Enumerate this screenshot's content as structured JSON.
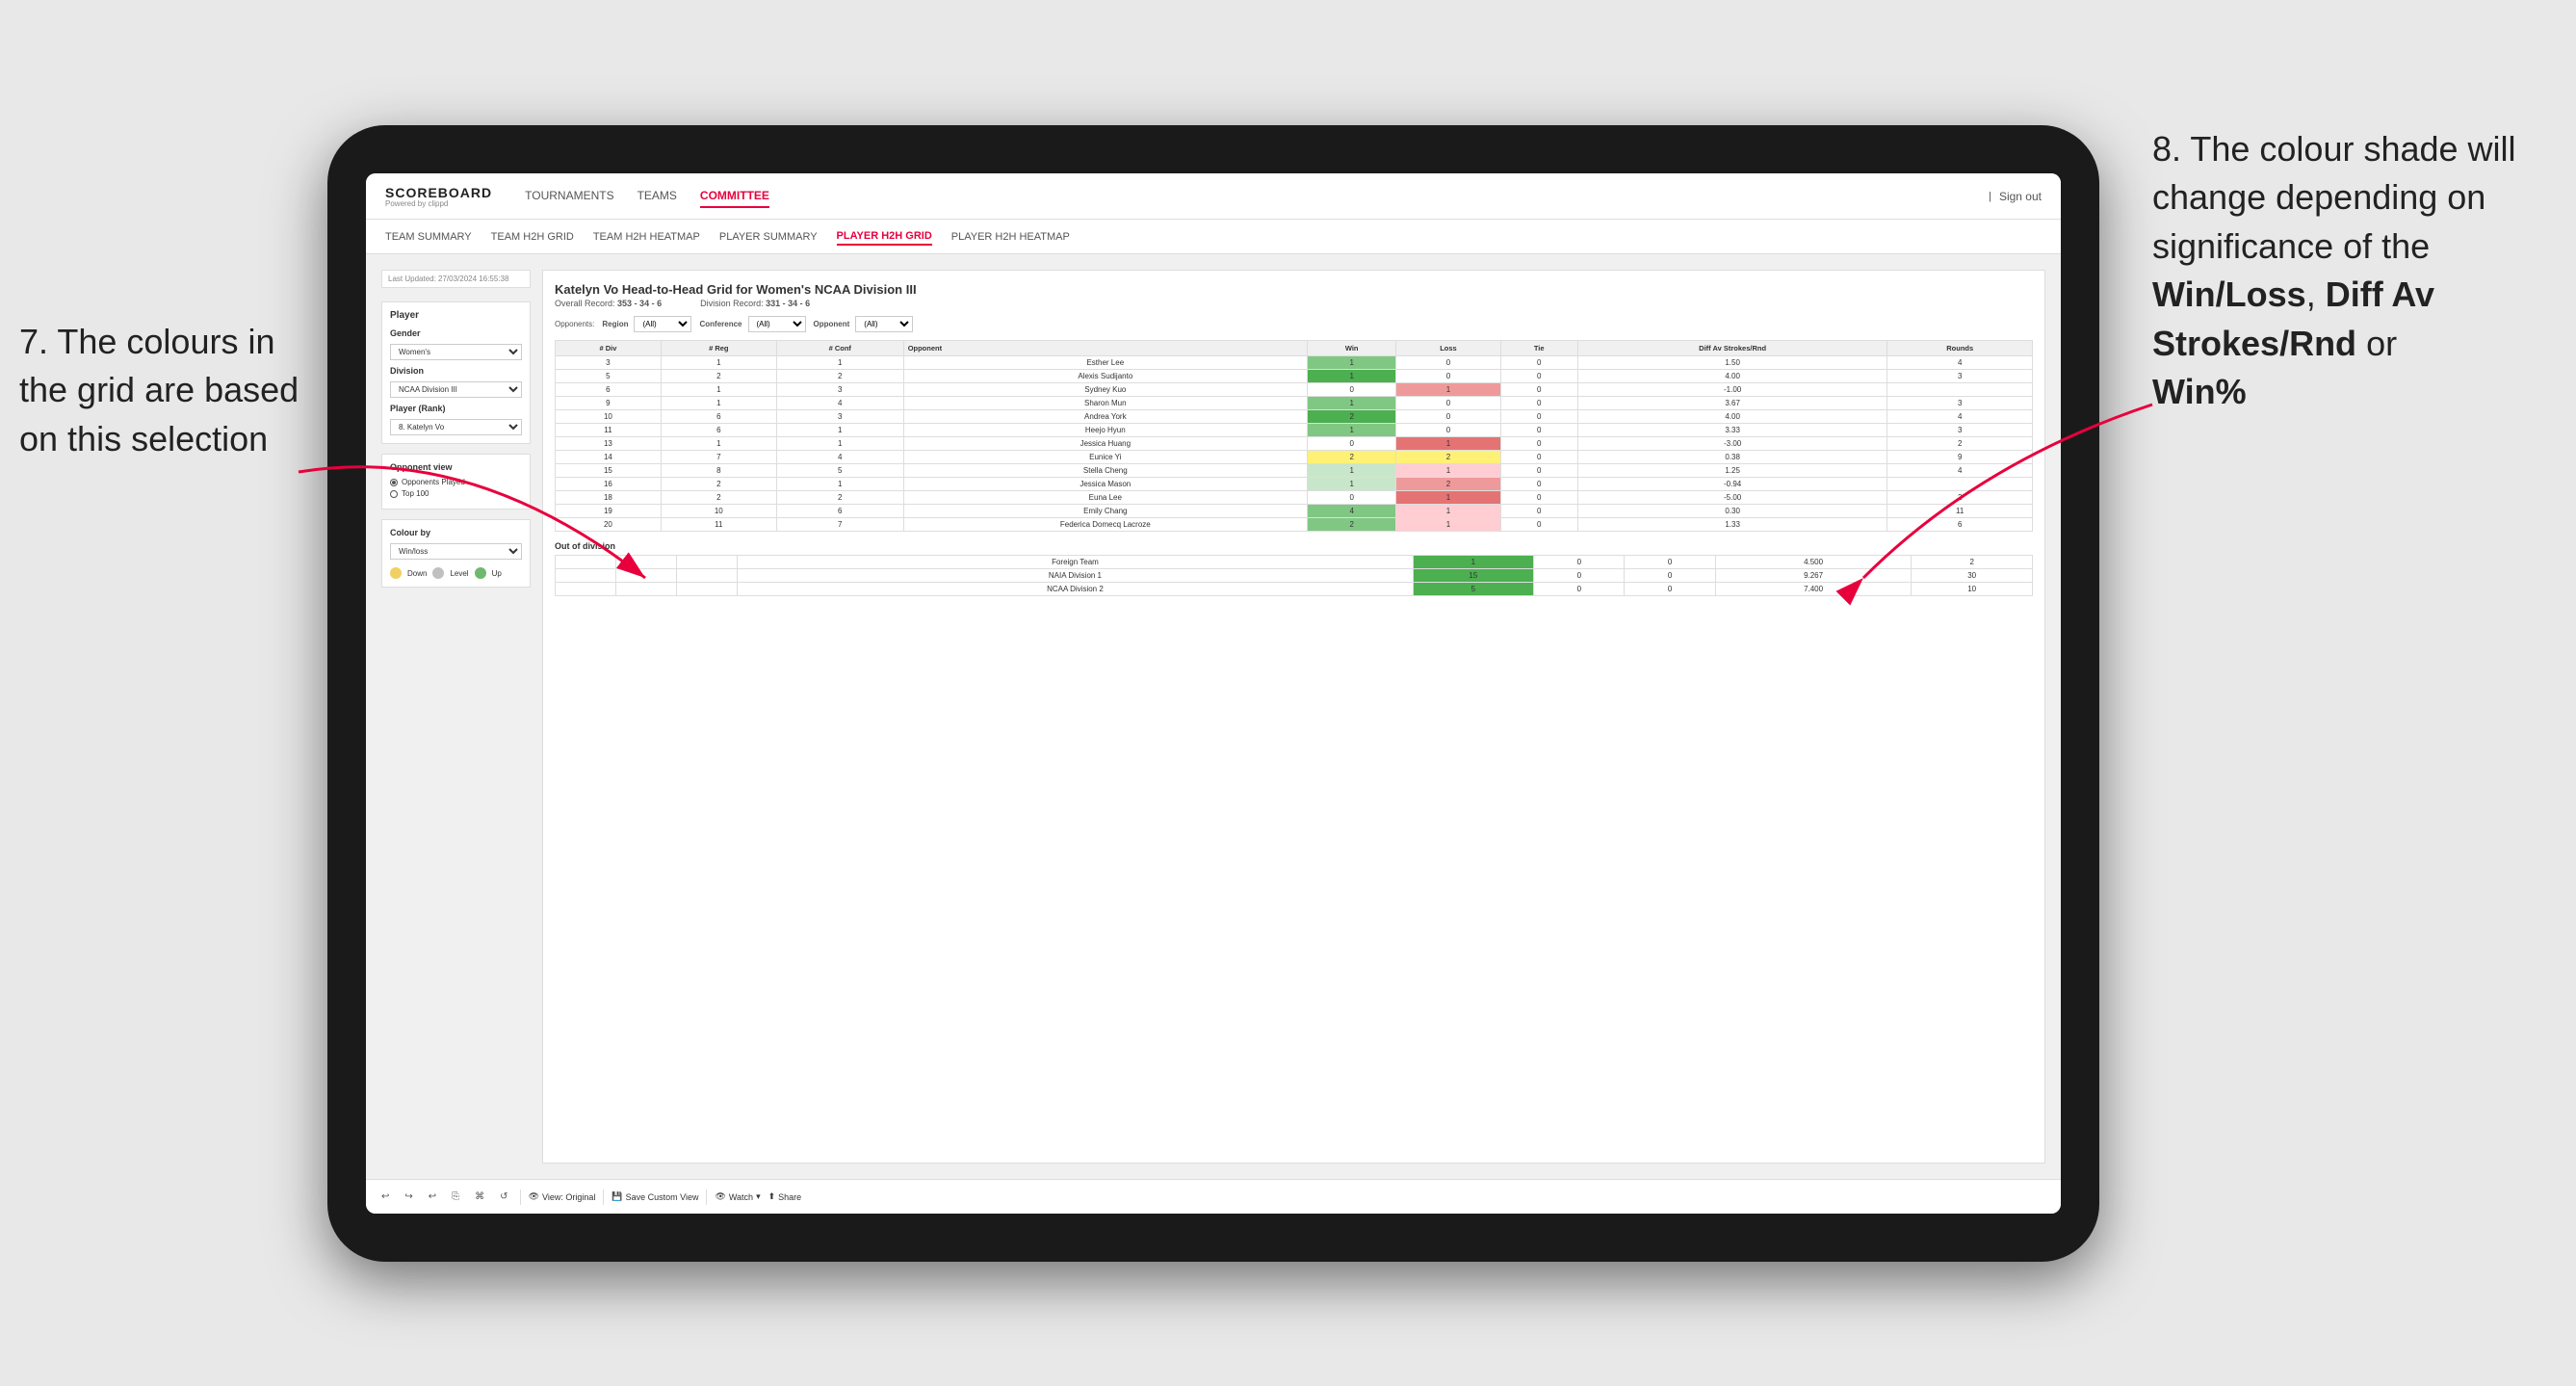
{
  "annotations": {
    "left_title": "7. The colours in the grid are based on this selection",
    "right_title": "8. The colour shade will change depending on significance of the",
    "right_bold1": "Win/Loss",
    "right_comma1": ", ",
    "right_bold2": "Diff Av Strokes/Rnd",
    "right_or": " or",
    "right_bold3": "Win%"
  },
  "nav": {
    "logo": "SCOREBOARD",
    "logo_sub": "Powered by clippd",
    "links": [
      "TOURNAMENTS",
      "TEAMS",
      "COMMITTEE"
    ],
    "active_link": "COMMITTEE",
    "right_items": [
      "Sign out"
    ]
  },
  "sub_nav": {
    "links": [
      "TEAM SUMMARY",
      "TEAM H2H GRID",
      "TEAM H2H HEATMAP",
      "PLAYER SUMMARY",
      "PLAYER H2H GRID",
      "PLAYER H2H HEATMAP"
    ],
    "active_link": "PLAYER H2H GRID"
  },
  "sidebar": {
    "last_updated": "Last Updated: 27/03/2024 16:55:38",
    "player_label": "Player",
    "gender_label": "Gender",
    "gender_value": "Women's",
    "division_label": "Division",
    "division_value": "NCAA Division III",
    "player_rank_label": "Player (Rank)",
    "player_rank_value": "8. Katelyn Vo",
    "opponent_view_label": "Opponent view",
    "opponent_options": [
      "Opponents Played",
      "Top 100"
    ],
    "selected_opponent": "Opponents Played",
    "colour_by_label": "Colour by",
    "colour_by_value": "Win/loss",
    "legend": [
      {
        "color": "#f0d060",
        "label": "Down"
      },
      {
        "color": "#c0c0c0",
        "label": "Level"
      },
      {
        "color": "#70b870",
        "label": "Up"
      }
    ]
  },
  "grid": {
    "title": "Katelyn Vo Head-to-Head Grid for Women's NCAA Division III",
    "overall_record_label": "Overall Record:",
    "overall_record": "353 - 34 - 6",
    "division_record_label": "Division Record:",
    "division_record": "331 - 34 - 6",
    "filter_label": "Opponents:",
    "filter_region_label": "Region",
    "filter_conference_label": "Conference",
    "filter_opponent_label": "Opponent",
    "filter_all": "(All)",
    "columns": [
      "# Div",
      "# Reg",
      "# Conf",
      "Opponent",
      "Win",
      "Loss",
      "Tie",
      "Diff Av Strokes/Rnd",
      "Rounds"
    ],
    "rows": [
      {
        "div": "3",
        "reg": "1",
        "conf": "1",
        "opponent": "Esther Lee",
        "win": "1",
        "loss": "0",
        "tie": "0",
        "diff": "1.50",
        "rounds": "4",
        "win_color": "cell-green-mid",
        "loss_color": "cell-white",
        "tie_color": "cell-white"
      },
      {
        "div": "5",
        "reg": "2",
        "conf": "2",
        "opponent": "Alexis Sudijanto",
        "win": "1",
        "loss": "0",
        "tie": "0",
        "diff": "4.00",
        "rounds": "3",
        "win_color": "cell-green-dark",
        "loss_color": "cell-white",
        "tie_color": "cell-white"
      },
      {
        "div": "6",
        "reg": "1",
        "conf": "3",
        "opponent": "Sydney Kuo",
        "win": "0",
        "loss": "1",
        "tie": "0",
        "diff": "-1.00",
        "rounds": "",
        "win_color": "cell-white",
        "loss_color": "cell-red-mid",
        "tie_color": "cell-white"
      },
      {
        "div": "9",
        "reg": "1",
        "conf": "4",
        "opponent": "Sharon Mun",
        "win": "1",
        "loss": "0",
        "tie": "0",
        "diff": "3.67",
        "rounds": "3",
        "win_color": "cell-green-mid",
        "loss_color": "cell-white",
        "tie_color": "cell-white"
      },
      {
        "div": "10",
        "reg": "6",
        "conf": "3",
        "opponent": "Andrea York",
        "win": "2",
        "loss": "0",
        "tie": "0",
        "diff": "4.00",
        "rounds": "4",
        "win_color": "cell-green-dark",
        "loss_color": "cell-white",
        "tie_color": "cell-white"
      },
      {
        "div": "11",
        "reg": "6",
        "conf": "1",
        "opponent": "Heejo Hyun",
        "win": "1",
        "loss": "0",
        "tie": "0",
        "diff": "3.33",
        "rounds": "3",
        "win_color": "cell-green-mid",
        "loss_color": "cell-white",
        "tie_color": "cell-white"
      },
      {
        "div": "13",
        "reg": "1",
        "conf": "1",
        "opponent": "Jessica Huang",
        "win": "0",
        "loss": "1",
        "tie": "0",
        "diff": "-3.00",
        "rounds": "2",
        "win_color": "cell-white",
        "loss_color": "cell-red-dark",
        "tie_color": "cell-white"
      },
      {
        "div": "14",
        "reg": "7",
        "conf": "4",
        "opponent": "Eunice Yi",
        "win": "2",
        "loss": "2",
        "tie": "0",
        "diff": "0.38",
        "rounds": "9",
        "win_color": "cell-yellow-mid",
        "loss_color": "cell-yellow-mid",
        "tie_color": "cell-white"
      },
      {
        "div": "15",
        "reg": "8",
        "conf": "5",
        "opponent": "Stella Cheng",
        "win": "1",
        "loss": "1",
        "tie": "0",
        "diff": "1.25",
        "rounds": "4",
        "win_color": "cell-green-light",
        "loss_color": "cell-red-light",
        "tie_color": "cell-white"
      },
      {
        "div": "16",
        "reg": "2",
        "conf": "1",
        "opponent": "Jessica Mason",
        "win": "1",
        "loss": "2",
        "tie": "0",
        "diff": "-0.94",
        "rounds": "",
        "win_color": "cell-green-light",
        "loss_color": "cell-red-mid",
        "tie_color": "cell-white"
      },
      {
        "div": "18",
        "reg": "2",
        "conf": "2",
        "opponent": "Euna Lee",
        "win": "0",
        "loss": "1",
        "tie": "0",
        "diff": "-5.00",
        "rounds": "2",
        "win_color": "cell-white",
        "loss_color": "cell-red-dark",
        "tie_color": "cell-white"
      },
      {
        "div": "19",
        "reg": "10",
        "conf": "6",
        "opponent": "Emily Chang",
        "win": "4",
        "loss": "1",
        "tie": "0",
        "diff": "0.30",
        "rounds": "11",
        "win_color": "cell-green-mid",
        "loss_color": "cell-red-light",
        "tie_color": "cell-white"
      },
      {
        "div": "20",
        "reg": "11",
        "conf": "7",
        "opponent": "Federica Domecq Lacroze",
        "win": "2",
        "loss": "1",
        "tie": "0",
        "diff": "1.33",
        "rounds": "6",
        "win_color": "cell-green-mid",
        "loss_color": "cell-red-light",
        "tie_color": "cell-white"
      }
    ],
    "out_of_division_label": "Out of division",
    "ood_rows": [
      {
        "label": "Foreign Team",
        "win": "1",
        "loss": "0",
        "tie": "0",
        "diff": "4.500",
        "rounds": "2",
        "win_color": "cell-green-dark",
        "loss_color": "cell-white",
        "tie_color": "cell-white"
      },
      {
        "label": "NAIA Division 1",
        "win": "15",
        "loss": "0",
        "tie": "0",
        "diff": "9.267",
        "rounds": "30",
        "win_color": "cell-green-dark",
        "loss_color": "cell-white",
        "tie_color": "cell-white"
      },
      {
        "label": "NCAA Division 2",
        "win": "5",
        "loss": "0",
        "tie": "0",
        "diff": "7.400",
        "rounds": "10",
        "win_color": "cell-green-dark",
        "loss_color": "cell-white",
        "tie_color": "cell-white"
      }
    ]
  },
  "toolbar": {
    "view_original": "View: Original",
    "save_custom": "Save Custom View",
    "watch": "Watch",
    "share": "Share"
  }
}
